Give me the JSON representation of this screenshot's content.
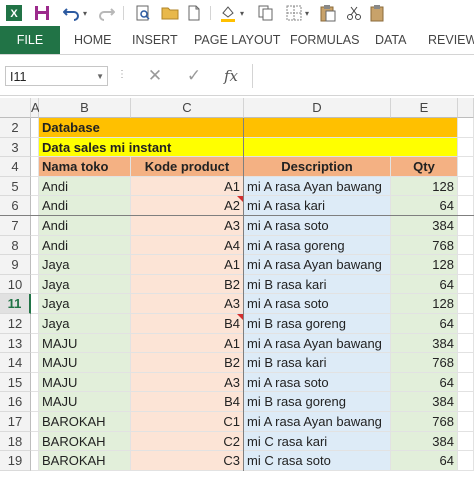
{
  "quick_access": {
    "icons": [
      "excel-logo-icon",
      "save-icon",
      "undo-icon",
      "redo-icon",
      "print-preview-icon",
      "open-folder-icon",
      "new-file-icon",
      "fill-color-icon",
      "copy-icon",
      "borders-icon",
      "paste-icon",
      "cut-icon",
      "paste-special-icon"
    ]
  },
  "ribbon": {
    "tabs": [
      "FILE",
      "HOME",
      "INSERT",
      "PAGE LAYOUT",
      "FORMULAS",
      "DATA",
      "REVIEW"
    ]
  },
  "formula_bar": {
    "name_box": "I11",
    "cancel_glyph": "✕",
    "enter_glyph": "✓",
    "fx_label": "fx",
    "formula": ""
  },
  "columns": [
    "A",
    "B",
    "C",
    "D",
    "E"
  ],
  "colors": {
    "accent": "#217346",
    "title_fill": "#ffc000",
    "subtitle_fill": "#ffff00",
    "header_fill": "#f4b183",
    "col_b_fill": "#e2efda",
    "col_c_fill": "#fce4d6",
    "col_d_fill": "#ddebf7",
    "col_e_fill": "#e2efda"
  },
  "rows": [
    {
      "num": "2",
      "b": "Database"
    },
    {
      "num": "3",
      "b": "Data sales mi instant"
    },
    {
      "num": "4",
      "b": "Nama toko",
      "c": "Kode product",
      "d": "Description",
      "e": "Qty"
    },
    {
      "num": "5",
      "b": "Andi",
      "c": "A1",
      "d": "mi A rasa Ayan bawang",
      "e": "128"
    },
    {
      "num": "6",
      "b": "Andi",
      "c": "A2",
      "d": "mi A rasa kari",
      "e": "64"
    },
    {
      "num": "7",
      "b": "Andi",
      "c": "A3",
      "d": "mi A rasa soto",
      "e": "384"
    },
    {
      "num": "8",
      "b": "Andi",
      "c": "A4",
      "d": "mi A rasa goreng",
      "e": "768"
    },
    {
      "num": "9",
      "b": "Jaya",
      "c": "A1",
      "d": "mi A rasa Ayan bawang",
      "e": "128"
    },
    {
      "num": "10",
      "b": "Jaya",
      "c": "B2",
      "d": "mi B rasa kari",
      "e": "64"
    },
    {
      "num": "11",
      "b": "Jaya",
      "c": "A3",
      "d": "mi A rasa soto",
      "e": "128"
    },
    {
      "num": "12",
      "b": "Jaya",
      "c": "B4",
      "d": "mi B rasa goreng",
      "e": "64"
    },
    {
      "num": "13",
      "b": "MAJU",
      "c": "A1",
      "d": "mi A rasa Ayan bawang",
      "e": "384"
    },
    {
      "num": "14",
      "b": "MAJU",
      "c": "B2",
      "d": "mi B rasa kari",
      "e": "768"
    },
    {
      "num": "15",
      "b": "MAJU",
      "c": "A3",
      "d": "mi A rasa soto",
      "e": "64"
    },
    {
      "num": "16",
      "b": "MAJU",
      "c": "B4",
      "d": "mi B rasa goreng",
      "e": "384"
    },
    {
      "num": "17",
      "b": "BAROKAH",
      "c": "C1",
      "d": "mi A rasa Ayan bawang",
      "e": "768"
    },
    {
      "num": "18",
      "b": "BAROKAH",
      "c": "C2",
      "d": "mi C rasa kari",
      "e": "384"
    },
    {
      "num": "19",
      "b": "BAROKAH",
      "c": "C3",
      "d": "mi C rasa soto",
      "e": "64"
    }
  ],
  "selected_row": "11"
}
